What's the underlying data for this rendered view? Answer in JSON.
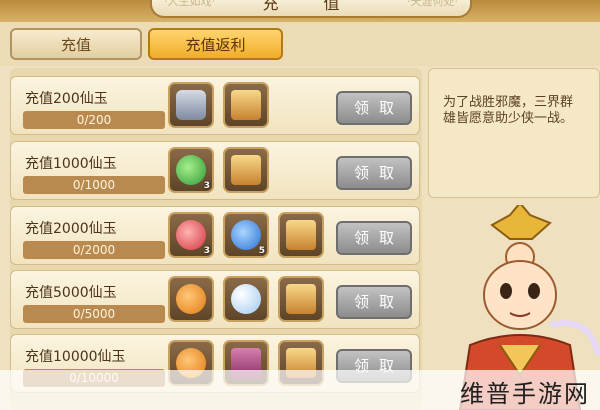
{
  "title": "充 值",
  "title_decor": [
    "·人生如戏·",
    "·天涯何处·"
  ],
  "tabs": [
    {
      "label": "充值",
      "active": false
    },
    {
      "label": "充值返利",
      "active": true
    }
  ],
  "rows": [
    {
      "title": "充值200仙玉",
      "progress": "0/200",
      "progress_fraction": 0,
      "rewards": [
        {
          "icon": "chest-icon",
          "count": ""
        },
        {
          "icon": "scroll-icon",
          "count": ""
        }
      ],
      "button": "领取"
    },
    {
      "title": "充值1000仙玉",
      "progress": "0/1000",
      "progress_fraction": 0,
      "rewards": [
        {
          "icon": "jade-orb-icon",
          "count": "3"
        },
        {
          "icon": "scroll-icon",
          "count": ""
        }
      ],
      "button": "领取"
    },
    {
      "title": "充值2000仙玉",
      "progress": "0/2000",
      "progress_fraction": 0,
      "rewards": [
        {
          "icon": "ruby-orb-icon",
          "count": "3"
        },
        {
          "icon": "sapphire-orb-icon",
          "count": "5"
        },
        {
          "icon": "scroll-icon",
          "count": ""
        }
      ],
      "button": "领取"
    },
    {
      "title": "充值5000仙玉",
      "progress": "0/5000",
      "progress_fraction": 0,
      "rewards": [
        {
          "icon": "gourd-icon",
          "count": ""
        },
        {
          "icon": "crystal-ball-icon",
          "count": ""
        },
        {
          "icon": "scroll-icon",
          "count": ""
        }
      ],
      "button": "领取"
    },
    {
      "title": "充值10000仙玉",
      "progress": "0/10000",
      "progress_fraction": 0,
      "rewards": [
        {
          "icon": "gourd-icon",
          "count": ""
        },
        {
          "icon": "book-icon",
          "count": ""
        },
        {
          "icon": "scroll-icon",
          "count": ""
        }
      ],
      "button": "领取"
    }
  ],
  "info_text": "为了战胜邪魔，三界群\n雄皆愿意助少侠一战。",
  "watermark": "维普手游网"
}
